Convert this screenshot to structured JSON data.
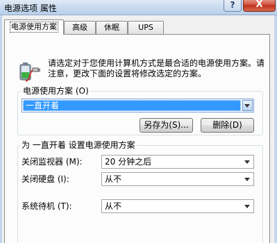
{
  "window": {
    "title": "电源选项 属性",
    "help_label": "?",
    "close_label": "X"
  },
  "tabs": [
    {
      "label": "电源使用方案",
      "active": true
    },
    {
      "label": "高级",
      "active": false
    },
    {
      "label": "休眠",
      "active": false
    },
    {
      "label": "UPS",
      "active": false
    }
  ],
  "intro": {
    "text": "请选定对于您使用计算机方式是最合适的电源使用方案。请注意，更改下面的设置将修改选定的方案。"
  },
  "scheme_group": {
    "label": "电源使用方案 (O)",
    "selected_scheme": "一直开着",
    "save_as_label": "另存为(S)...",
    "delete_label": "删除(D)"
  },
  "settings_group": {
    "label": "为 一直开着 设置电源使用方案",
    "rows": [
      {
        "label": "关闭监视器 (M):",
        "value": "20 分钟之后"
      },
      {
        "label": "关闭硬盘 (I):",
        "value": "从不"
      },
      {
        "label": "系统待机 (T):",
        "value": "从不"
      }
    ]
  },
  "colors": {
    "selection": "#3399ff",
    "close_button": "#c0321c",
    "titlebar": "#c9dbef"
  }
}
